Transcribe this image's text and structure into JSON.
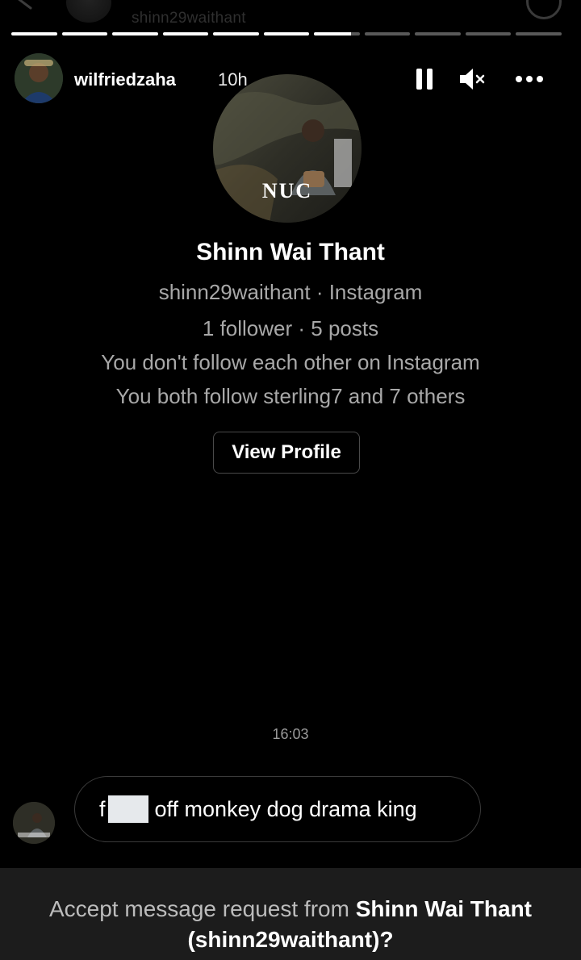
{
  "ghost_header": {
    "username": "shinn29waithant"
  },
  "progress": [
    1,
    1,
    1,
    1,
    1,
    1,
    0.8,
    0,
    0,
    0,
    0
  ],
  "header": {
    "username": "wilfriedzaha",
    "time": "10h",
    "icons": [
      "pause-icon",
      "muted-speaker-icon",
      "more-options-icon"
    ]
  },
  "profile": {
    "picture_badge": "NUC",
    "name": "Shinn Wai Thant",
    "handle_line": "shinn29waithant · Instagram",
    "stats_line": "1 follower · 5 posts",
    "follow_line": "You don't follow each other on Instagram",
    "mutual_line": "You both follow sterling7 and 7 others",
    "view_button": "View Profile"
  },
  "thread": {
    "timestamp": "16:03",
    "message_prefix": "f",
    "message_rest": "off monkey dog drama king"
  },
  "request_bar": {
    "prefix": "Accept message request from ",
    "name": "Shinn Wai Thant",
    "handle": "(shinn29waithant)?"
  },
  "colors": {
    "background": "#000000",
    "muted_text": "#a8a8a8",
    "bar": "#1c1c1c",
    "censor": "#e6e9ec"
  }
}
